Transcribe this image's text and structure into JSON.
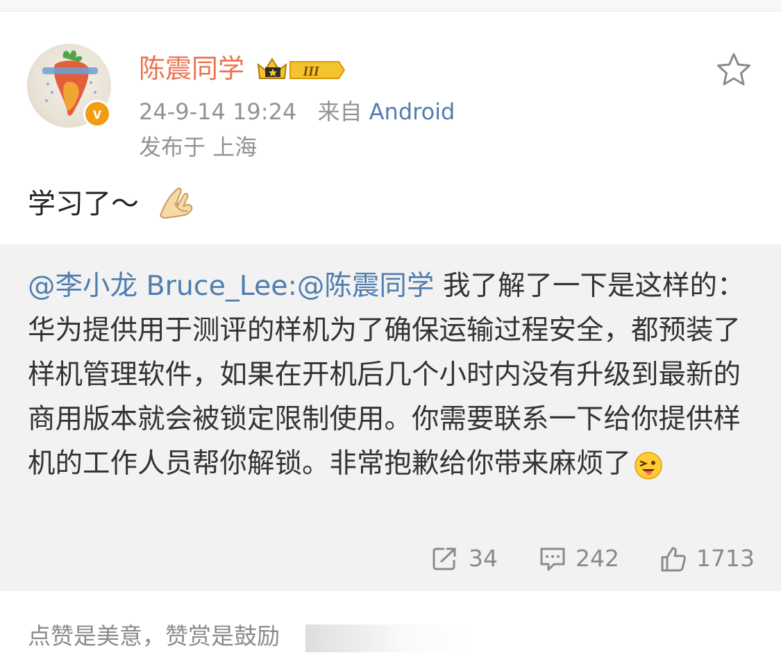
{
  "user": {
    "name": "陈震同学",
    "level_badge": "III",
    "verified_badge": "v"
  },
  "post": {
    "date": "24-9-14 19:24",
    "source_prefix": "来自",
    "source": "Android",
    "location": "发布于 上海",
    "text": "学习了～"
  },
  "retweet": {
    "mention_author": "@李小龙 Bruce_Lee:@陈震同学",
    "body": " 我了解了一下是这样的：华为提供用于测评的样机为了确保运输过程安全，都预装了样机管理软件，如果在开机后几个小时内没有升级到最新的商用版本就会被锁定限制使用。你需要联系一下给你提供样机的工作人员帮你解锁。非常抱歉给你带来麻烦了"
  },
  "stats": {
    "reposts": "34",
    "comments": "242",
    "likes": "1713"
  },
  "footer": {
    "reward_text": "点赞是美意，赞赏是鼓励"
  },
  "colors": {
    "username": "#eb7350",
    "link": "#507daf",
    "meta": "#939393",
    "retweet_bg": "#f2f2f2"
  },
  "icons": [
    "star-icon",
    "crown-icon",
    "repost-icon",
    "comment-icon",
    "like-icon"
  ]
}
